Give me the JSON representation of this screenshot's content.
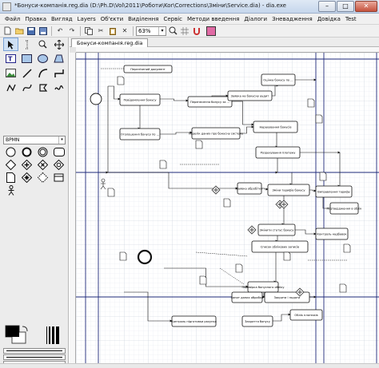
{
  "window": {
    "title": "*Бонуси-компанія.reg.dia (D:\\Ph.D\\Vol\\2011\\Роботи\\Kor\\Corrections\\Зміни\\Service.dia) - dia.exe",
    "minimize_label": "–",
    "maximize_label": "□",
    "close_label": "✕"
  },
  "menu": [
    "Файл",
    "Правка",
    "Вигляд",
    "Layers",
    "Об'єкти",
    "Виділення",
    "Сервіс",
    "Методи введення",
    "Діалоги",
    "Зневадження",
    "Довідка",
    "Test"
  ],
  "toolbar": {
    "zoom": "63%",
    "zoom_arrow": "▾",
    "accent_color": "#e06aa4"
  },
  "toolbox": {
    "sheet": "BPMN",
    "sheet_arrow": "▾",
    "tools": [
      "pointer-icon",
      "text-cursor-icon",
      "zoom-icon",
      "move-icon",
      "text-icon",
      "box-icon",
      "ellipse-icon",
      "polygon-icon",
      "image-icon",
      "line-icon",
      "arc-icon",
      "zigzag-icon",
      "polyline-icon",
      "bezier-icon",
      "outline-icon",
      "freehand-icon"
    ],
    "shapes": [
      "bpmn-circle-icon",
      "bpmn-thick-circle-icon",
      "bpmn-double-circle-icon",
      "bpmn-rounded-rect-icon",
      "bpmn-gateway-icon",
      "bpmn-gateway-plus-icon",
      "bpmn-gateway-x-icon",
      "bpmn-gateway-circle-icon",
      "bpmn-document-icon",
      "bpmn-gateway-star-icon",
      "bpmn-dashed-diamond-icon",
      "bpmn-data-store-icon",
      "bpmn-actor-icon"
    ],
    "foreground_color": "#000000",
    "background_color": "#ffffff"
  },
  "document": {
    "tab_label": "Бонуси-компанія.reg.dia"
  },
  "diagram": {
    "nodes": [
      "Перелічений документ",
      "Повідомлення бонусу",
      "Оголошення бонусу по ...",
      "Перенесення бонусу за ...",
      "Оцінка бонусу по ...",
      "Заявка на бонусну аудит",
      "Перелік даних про бонусну систему",
      "Нарахування бонусів",
      "Розрахування платежу",
      "Заявка обробітку",
      "Зміни тарифів бонусу",
      "Виправлення тарифу",
      "Підтвердження в облік",
      "Змінити статус бонусу",
      "Список облікових записів",
      "Контроль надбавок",
      "Перевірка бонусного обліку",
      "Закриття бонусу",
      "Контроль підготовки рахунка",
      "Облік платежів",
      "Закрити і подати",
      "Запит даних обробки"
    ]
  }
}
